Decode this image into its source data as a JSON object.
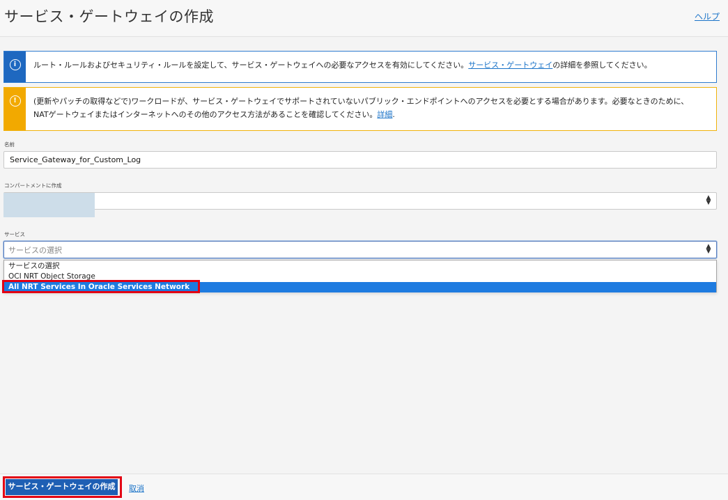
{
  "header": {
    "title": "サービス・ゲートウェイの作成",
    "help_link": "ヘルプ"
  },
  "alerts": {
    "info": {
      "text": "ルート・ルールおよびセキュリティ・ルールを設定して、サービス・ゲートウェイへの必要なアクセスを有効にしてください。",
      "link": "サービス・ゲートウェイ",
      "text_after": "の詳細を参照してください。"
    },
    "warning": {
      "text": "(更新やパッチの取得などで)ワークロードが、サービス・ゲートウェイでサポートされていないパブリック・エンドポイントへのアクセスを必要とする場合があります。必要なときのために、NATゲートウェイまたはインターネットへのその他のアクセス方法があることを確認してください。",
      "link": "詳細",
      "text_after": "."
    }
  },
  "form": {
    "name": {
      "label": "名前",
      "value": "Service_Gateway_for_Custom_Log"
    },
    "compartment": {
      "label": "コンパートメントに作成"
    },
    "service": {
      "label": "サービス",
      "placeholder": "サービスの選択",
      "options": [
        "サービスの選択",
        "OCI NRT Object Storage",
        "All NRT Services In Oracle Services Network"
      ],
      "selected_index": 2
    }
  },
  "footer": {
    "create_button": "サービス・ゲートウェイの作成",
    "cancel_link": "取消"
  },
  "colors": {
    "primary": "#1e5fb4",
    "info": "#1e68c0",
    "warning": "#f2a900",
    "highlight": "#e30013",
    "selected_option": "#1e7be0"
  }
}
